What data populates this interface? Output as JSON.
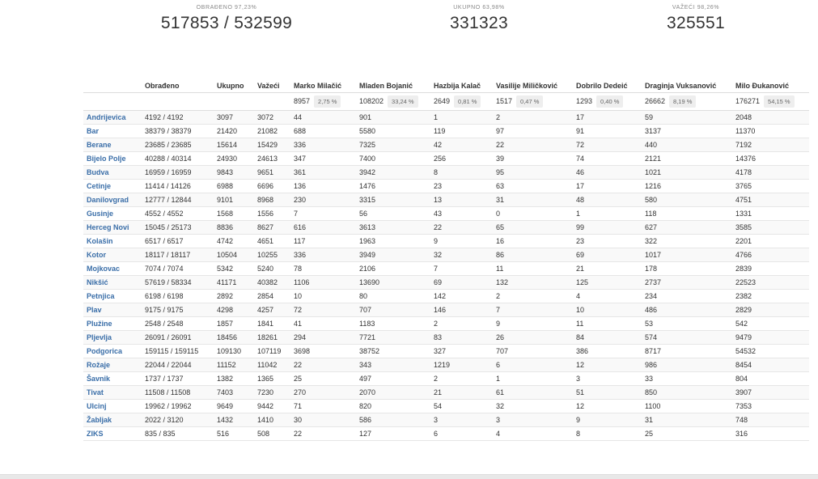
{
  "stats": [
    {
      "label": "OBRAĐENO 97,23%",
      "value": "517853 / 532599"
    },
    {
      "label": "UKUPNO 63,98%",
      "value": "331323"
    },
    {
      "label": "VAŽEĆI 98,26%",
      "value": "325551"
    }
  ],
  "headers": [
    "",
    "Obrađeno",
    "Ukupno",
    "Važeći",
    "Marko Milačić",
    "Mladen Bojanić",
    "Hazbija Kalač",
    "Vasilije Miličković",
    "Dobrilo Dedeić",
    "Draginja Vuksanović",
    "Milo Đukanović"
  ],
  "totals": [
    {
      "value": "8957",
      "pct": "2,75 %"
    },
    {
      "value": "108202",
      "pct": "33,24 %"
    },
    {
      "value": "2649",
      "pct": "0,81 %"
    },
    {
      "value": "1517",
      "pct": "0,47 %"
    },
    {
      "value": "1293",
      "pct": "0,40 %"
    },
    {
      "value": "26662",
      "pct": "8,19 %"
    },
    {
      "value": "176271",
      "pct": "54,15 %"
    }
  ],
  "rows": [
    [
      "Andrijevica",
      "4192 / 4192",
      "3097",
      "3072",
      "44",
      "901",
      "1",
      "2",
      "17",
      "59",
      "2048"
    ],
    [
      "Bar",
      "38379 / 38379",
      "21420",
      "21082",
      "688",
      "5580",
      "119",
      "97",
      "91",
      "3137",
      "11370"
    ],
    [
      "Berane",
      "23685 / 23685",
      "15614",
      "15429",
      "336",
      "7325",
      "42",
      "22",
      "72",
      "440",
      "7192"
    ],
    [
      "Bijelo Polje",
      "40288 / 40314",
      "24930",
      "24613",
      "347",
      "7400",
      "256",
      "39",
      "74",
      "2121",
      "14376"
    ],
    [
      "Budva",
      "16959 / 16959",
      "9843",
      "9651",
      "361",
      "3942",
      "8",
      "95",
      "46",
      "1021",
      "4178"
    ],
    [
      "Cetinje",
      "11414 / 14126",
      "6988",
      "6696",
      "136",
      "1476",
      "23",
      "63",
      "17",
      "1216",
      "3765"
    ],
    [
      "Danilovgrad",
      "12777 / 12844",
      "9101",
      "8968",
      "230",
      "3315",
      "13",
      "31",
      "48",
      "580",
      "4751"
    ],
    [
      "Gusinje",
      "4552 / 4552",
      "1568",
      "1556",
      "7",
      "56",
      "43",
      "0",
      "1",
      "118",
      "1331"
    ],
    [
      "Herceg Novi",
      "15045 / 25173",
      "8836",
      "8627",
      "616",
      "3613",
      "22",
      "65",
      "99",
      "627",
      "3585"
    ],
    [
      "Kolašin",
      "6517 / 6517",
      "4742",
      "4651",
      "117",
      "1963",
      "9",
      "16",
      "23",
      "322",
      "2201"
    ],
    [
      "Kotor",
      "18117 / 18117",
      "10504",
      "10255",
      "336",
      "3949",
      "32",
      "86",
      "69",
      "1017",
      "4766"
    ],
    [
      "Mojkovac",
      "7074 / 7074",
      "5342",
      "5240",
      "78",
      "2106",
      "7",
      "11",
      "21",
      "178",
      "2839"
    ],
    [
      "Nikšić",
      "57619 / 58334",
      "41171",
      "40382",
      "1106",
      "13690",
      "69",
      "132",
      "125",
      "2737",
      "22523"
    ],
    [
      "Petnjica",
      "6198 / 6198",
      "2892",
      "2854",
      "10",
      "80",
      "142",
      "2",
      "4",
      "234",
      "2382"
    ],
    [
      "Plav",
      "9175 / 9175",
      "4298",
      "4257",
      "72",
      "707",
      "146",
      "7",
      "10",
      "486",
      "2829"
    ],
    [
      "Plužine",
      "2548 / 2548",
      "1857",
      "1841",
      "41",
      "1183",
      "2",
      "9",
      "11",
      "53",
      "542"
    ],
    [
      "Pljevlja",
      "26091 / 26091",
      "18456",
      "18261",
      "294",
      "7721",
      "83",
      "26",
      "84",
      "574",
      "9479"
    ],
    [
      "Podgorica",
      "159115 / 159115",
      "109130",
      "107119",
      "3698",
      "38752",
      "327",
      "707",
      "386",
      "8717",
      "54532"
    ],
    [
      "Rožaje",
      "22044 / 22044",
      "11152",
      "11042",
      "22",
      "343",
      "1219",
      "6",
      "12",
      "986",
      "8454"
    ],
    [
      "Šavnik",
      "1737 / 1737",
      "1382",
      "1365",
      "25",
      "497",
      "2",
      "1",
      "3",
      "33",
      "804"
    ],
    [
      "Tivat",
      "11508 / 11508",
      "7403",
      "7230",
      "270",
      "2070",
      "21",
      "61",
      "51",
      "850",
      "3907"
    ],
    [
      "Ulcinj",
      "19962 / 19962",
      "9649",
      "9442",
      "71",
      "820",
      "54",
      "32",
      "12",
      "1100",
      "7353"
    ],
    [
      "Žabljak",
      "2022 / 3120",
      "1432",
      "1410",
      "30",
      "586",
      "3",
      "3",
      "9",
      "31",
      "748"
    ],
    [
      "ZIKS",
      "835 / 835",
      "516",
      "508",
      "22",
      "127",
      "6",
      "4",
      "8",
      "25",
      "316"
    ]
  ]
}
